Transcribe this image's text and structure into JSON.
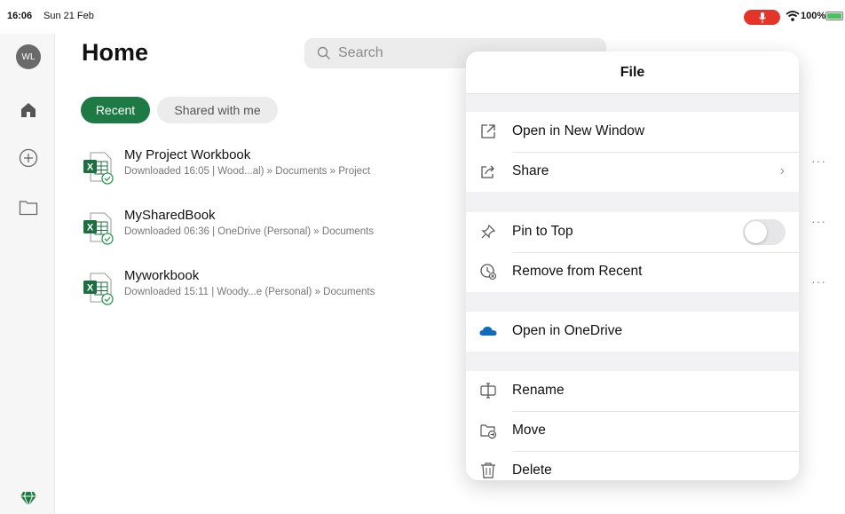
{
  "status": {
    "time": "16:06",
    "date": "Sun 21 Feb",
    "battery": "100%",
    "battery_level": 1.0,
    "mic_color": "#e5352b"
  },
  "rail": {
    "avatar_initials": "WL",
    "icons": [
      "home-icon",
      "add-circle-icon",
      "folder-icon",
      "premium-gem-icon"
    ]
  },
  "main": {
    "title": "Home",
    "search_placeholder": "Search",
    "tabs": [
      {
        "label": "Recent",
        "active": true
      },
      {
        "label": "Shared with me",
        "active": false
      }
    ],
    "files": [
      {
        "name": "My Project Workbook",
        "sub": "Downloaded 16:05 | Wood...al) » Documents » Project",
        "icon": "excel-file-icon"
      },
      {
        "name": "MySharedBook",
        "sub": "Downloaded 06:36 | OneDrive (Personal) » Documents",
        "icon": "excel-file-icon"
      },
      {
        "name": "Myworkbook",
        "sub": "Downloaded 15:11 | Woody...e (Personal) » Documents",
        "icon": "excel-file-icon"
      }
    ],
    "more_label": "···"
  },
  "menu": {
    "title": "File",
    "groups": [
      [
        {
          "label": "Open in New Window",
          "icon": "open-window-icon"
        },
        {
          "label": "Share",
          "icon": "share-icon",
          "chevron": "›"
        }
      ],
      [
        {
          "label": "Pin to Top",
          "icon": "pin-icon",
          "toggle": false
        },
        {
          "label": "Remove from Recent",
          "icon": "clock-remove-icon"
        }
      ],
      [
        {
          "label": "Open in OneDrive",
          "icon": "onedrive-cloud-icon"
        }
      ],
      [
        {
          "label": "Rename",
          "icon": "rename-icon"
        },
        {
          "label": "Move",
          "icon": "move-folder-icon"
        },
        {
          "label": "Delete",
          "icon": "trash-icon"
        }
      ]
    ]
  },
  "colors": {
    "accent": "#1e7a45",
    "excel_green": "#1d6f42",
    "onedrive_blue": "#0f6cbd"
  }
}
